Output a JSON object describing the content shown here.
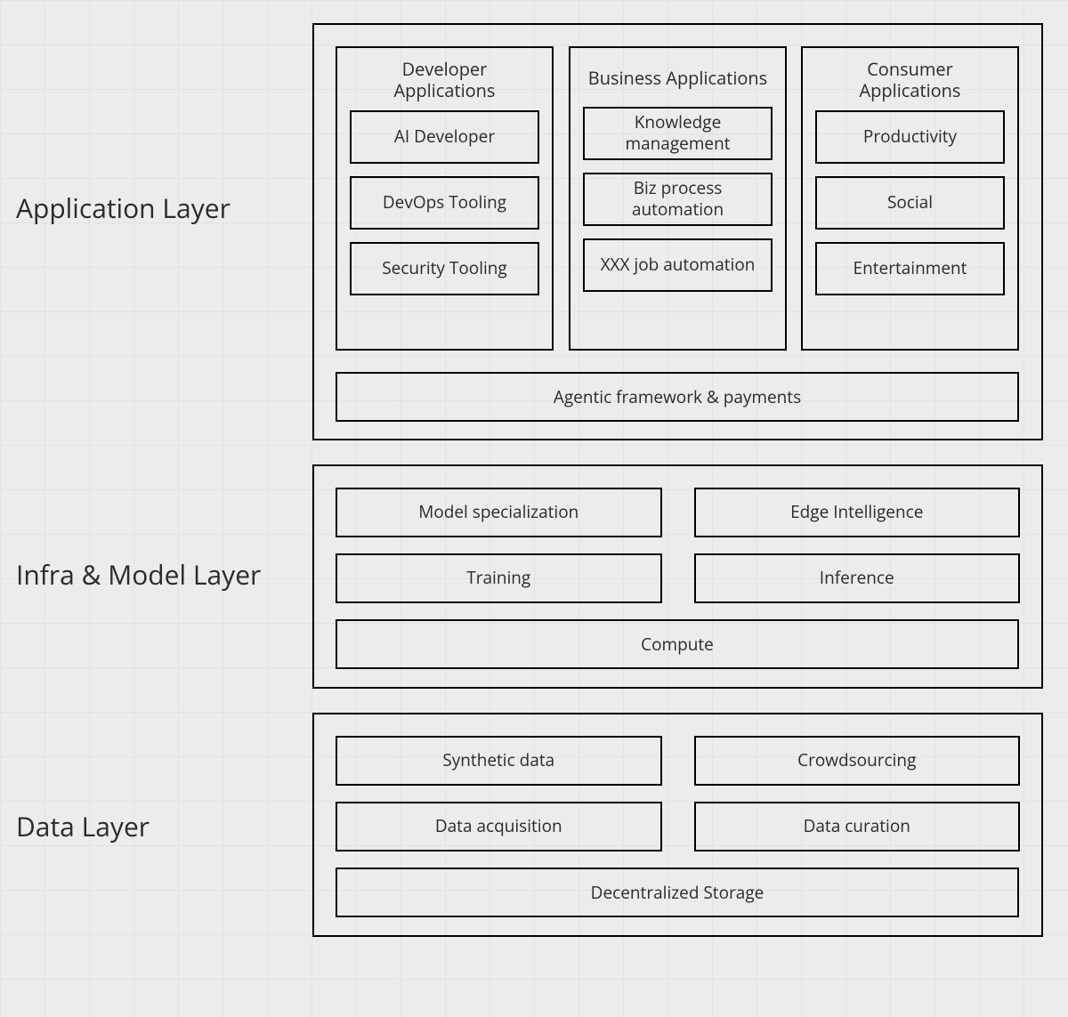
{
  "layers": {
    "application": {
      "label": "Application Layer",
      "groups": [
        {
          "title": "Developer Applications",
          "items": [
            "AI Developer",
            "DevOps Tooling",
            "Security Tooling"
          ]
        },
        {
          "title": "Business Applications",
          "items": [
            "Knowledge management",
            "Biz process automation",
            "XXX job automation"
          ]
        },
        {
          "title": "Consumer Applications",
          "items": [
            "Productivity",
            "Social",
            "Entertainment"
          ]
        }
      ],
      "footer": "Agentic framework & payments"
    },
    "infra": {
      "label": "Infra & Model Layer",
      "rows": [
        [
          "Model specialization",
          "Edge Intelligence"
        ],
        [
          "Training",
          "Inference"
        ]
      ],
      "footer": "Compute"
    },
    "data": {
      "label": "Data Layer",
      "rows": [
        [
          "Synthetic data",
          "Crowdsourcing"
        ],
        [
          "Data acquisition",
          "Data curation"
        ]
      ],
      "footer": "Decentralized Storage"
    }
  }
}
